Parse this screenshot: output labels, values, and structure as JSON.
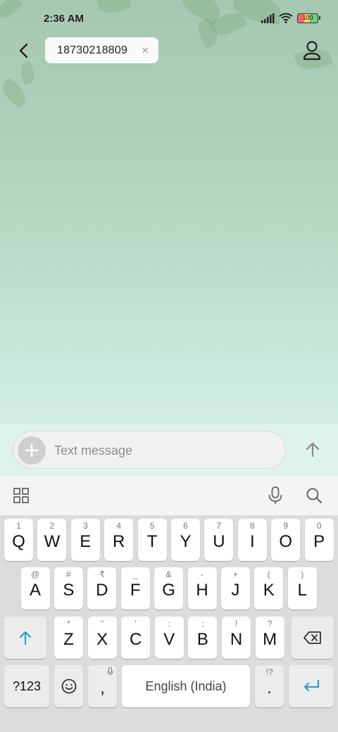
{
  "status_bar": {
    "time": "2:36 AM",
    "battery": "100"
  },
  "header": {
    "recipient": "18730218809",
    "remove_glyph": "×"
  },
  "composer": {
    "placeholder": "Text message"
  },
  "keyboard": {
    "row1": [
      {
        "hint": "1",
        "key": "Q"
      },
      {
        "hint": "2",
        "key": "W"
      },
      {
        "hint": "3",
        "key": "E"
      },
      {
        "hint": "4",
        "key": "R"
      },
      {
        "hint": "5",
        "key": "T"
      },
      {
        "hint": "6",
        "key": "Y"
      },
      {
        "hint": "7",
        "key": "U"
      },
      {
        "hint": "8",
        "key": "I"
      },
      {
        "hint": "9",
        "key": "O"
      },
      {
        "hint": "0",
        "key": "P"
      }
    ],
    "row2": [
      {
        "hint": "@",
        "key": "A"
      },
      {
        "hint": "#",
        "key": "S"
      },
      {
        "hint": "₹",
        "key": "D"
      },
      {
        "hint": "_",
        "key": "F"
      },
      {
        "hint": "&",
        "key": "G"
      },
      {
        "hint": "-",
        "key": "H"
      },
      {
        "hint": "+",
        "key": "J"
      },
      {
        "hint": "(",
        "key": "K"
      },
      {
        "hint": ")",
        "key": "L"
      }
    ],
    "row3": [
      {
        "hint": "*",
        "key": "Z"
      },
      {
        "hint": "\"",
        "key": "X"
      },
      {
        "hint": "'",
        "key": "C"
      },
      {
        "hint": ":",
        "key": "V"
      },
      {
        "hint": ";",
        "key": "B"
      },
      {
        "hint": "!",
        "key": "N"
      },
      {
        "hint": "?",
        "key": "M"
      }
    ],
    "symbols_label": "?123",
    "comma": ",",
    "space_label": "English (India)",
    "period": ".",
    "period_hint": "!?",
    "accent_color": "#2a9fd8"
  }
}
